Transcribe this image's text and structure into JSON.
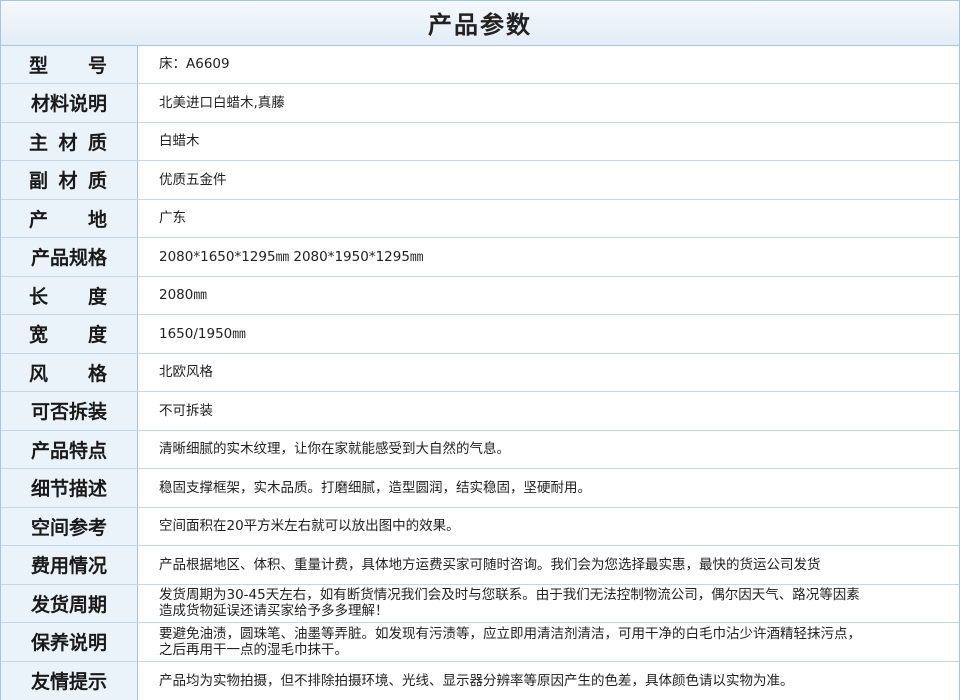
{
  "title": "产品参数",
  "rows": [
    {
      "label": "型号",
      "spread": [
        "型",
        "号"
      ],
      "value": "床：A6609"
    },
    {
      "label": "材料说明",
      "value": "北美进口白蜡木,真藤"
    },
    {
      "label": "主材质",
      "spread": [
        "主",
        "材",
        "质"
      ],
      "value": "白蜡木"
    },
    {
      "label": "副材质",
      "spread": [
        "副",
        "材",
        "质"
      ],
      "value": "优质五金件"
    },
    {
      "label": "产地",
      "spread": [
        "产",
        "地"
      ],
      "value": "广东"
    },
    {
      "label": "产品规格",
      "value": "2080*1650*1295㎜  2080*1950*1295㎜"
    },
    {
      "label": "长度",
      "spread": [
        "长",
        "度"
      ],
      "value": "2080㎜"
    },
    {
      "label": "宽度",
      "spread": [
        "宽",
        "度"
      ],
      "value": "1650/1950㎜"
    },
    {
      "label": "风格",
      "spread": [
        "风",
        "格"
      ],
      "value": "北欧风格"
    },
    {
      "label": "可否拆装",
      "value": "不可拆装"
    },
    {
      "label": "产品特点",
      "value": "清晰细腻的实木纹理，让你在家就能感受到大自然的气息。"
    },
    {
      "label": "细节描述",
      "value": "稳固支撑框架，实木品质。打磨细腻，造型圆润，结实稳固，坚硬耐用。"
    },
    {
      "label": "空间参考",
      "value": "空间面积在20平方米左右就可以放出图中的效果。"
    },
    {
      "label": "费用情况",
      "value": "产品根据地区、体积、重量计费，具体地方运费买家可随时咨询。我们会为您选择最实惠，最快的货运公司发货"
    },
    {
      "label": "发货周期",
      "value": "发货周期为30-45天左右，如有断货情况我们会及时与您联系。由于我们无法控制物流公司，偶尔因天气、路况等因素\n造成货物延误还请买家给予多多理解！"
    },
    {
      "label": "保养说明",
      "value": "要避免油渍，圆珠笔、油墨等弄脏。如发现有污渍等，应立即用清洁剂清洁，可用干净的白毛巾沾少许酒精轻抹污点，\n之后再用干一点的湿毛巾抹干。"
    },
    {
      "label": "友情提示",
      "value": "产品均为实物拍摄，但不排除拍摄环境、光线、显示器分辨率等原因产生的色差，具体颜色请以实物为准。"
    }
  ]
}
